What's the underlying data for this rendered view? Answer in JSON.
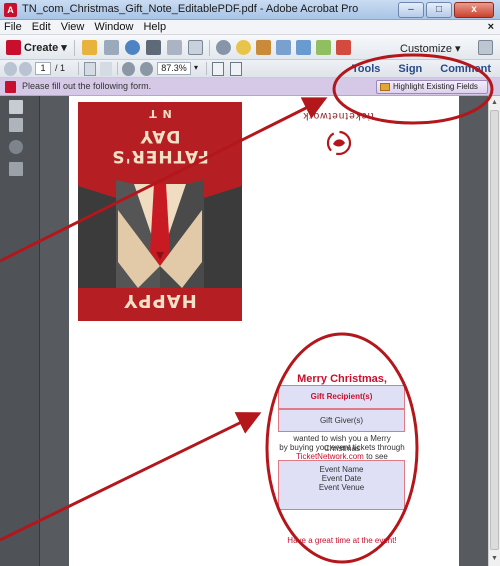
{
  "window": {
    "title": "TN_com_Christmas_Gift_Note_EditablePDF.pdf - Adobe Acrobat Pro",
    "buttons": {
      "minimize": "–",
      "maximize": "□",
      "close": "x"
    }
  },
  "menu": {
    "items": [
      "File",
      "Edit",
      "View",
      "Window",
      "Help"
    ],
    "close_glyph": "×"
  },
  "toolbar": {
    "create_label": "Create",
    "customize_label": "Customize"
  },
  "nav": {
    "page_current": "1",
    "page_total": "/ 1",
    "zoom": "87.3%",
    "tabs": [
      "Tools",
      "Sign",
      "Comment"
    ]
  },
  "form_bar": {
    "message": "Please fill out the following form.",
    "highlight_button": "Highlight Existing Fields"
  },
  "document": {
    "card": {
      "top_text": "HAPPY",
      "line1": "FATHER'S",
      "line2": "DAY",
      "line3": "N T"
    },
    "logo": "ticketnetwork",
    "greeting": "Merry Christmas,",
    "recipient_field": "Gift Recipient(s)",
    "giver_field": "Gift Giver(s)",
    "wish_text_1": "wanted to wish you a Merry Christmas",
    "wish_text_2": "by buying you event tickets through",
    "link": "TicketNetwork.com",
    "link_suffix": " to see",
    "event_name": "Event Name",
    "event_date": "Event Date",
    "event_venue": "Event Venue",
    "closing": "Have a great time at the event!"
  },
  "colors": {
    "annotation_red": "#b3161b",
    "brand_red": "#c8102e",
    "form_bar": "#d6c9e8"
  }
}
